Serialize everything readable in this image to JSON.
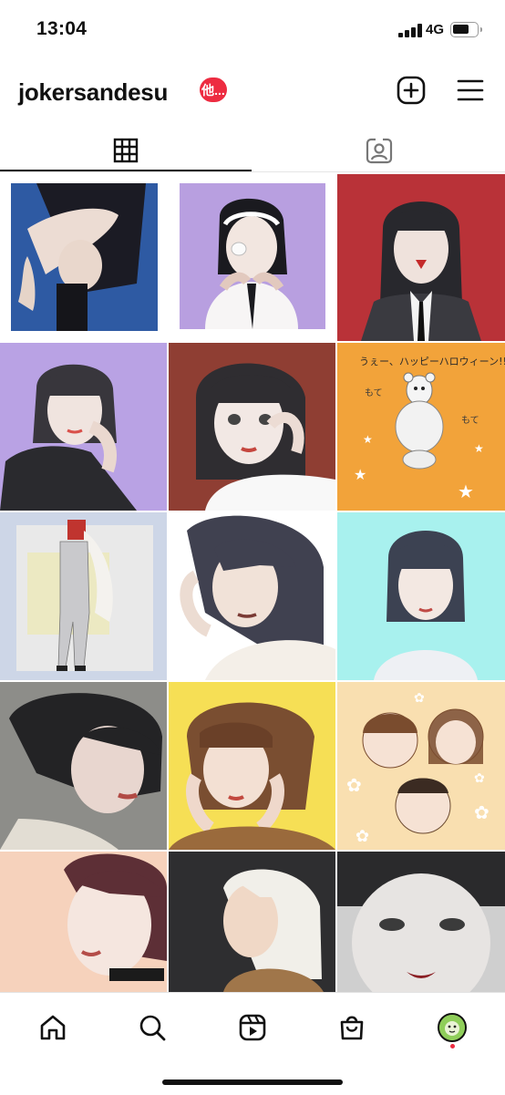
{
  "status_bar": {
    "time": "13:04",
    "network": "4G"
  },
  "header": {
    "username": "jokersandesu",
    "notification_badge": "他..."
  },
  "icons": {
    "create": "plus-square-icon",
    "menu": "hamburger-menu-icon",
    "grid_tab": "grid-icon",
    "tagged_tab": "person-tag-icon",
    "home": "home-icon",
    "search": "search-icon",
    "reels": "reels-icon",
    "shop": "shop-bag-icon"
  },
  "colors": {
    "badge": "#ed2c41",
    "text": "#111111"
  },
  "grid": {
    "posts": [
      "post-01",
      "post-02",
      "post-03",
      "post-04",
      "post-05",
      "post-06",
      "post-07",
      "post-08",
      "post-09",
      "post-10",
      "post-11",
      "post-12",
      "post-13",
      "post-14",
      "post-15"
    ],
    "post6_caption": "うぇー、ハッピーハロウィーン!!",
    "post6_words": [
      "もて",
      "もて"
    ]
  }
}
